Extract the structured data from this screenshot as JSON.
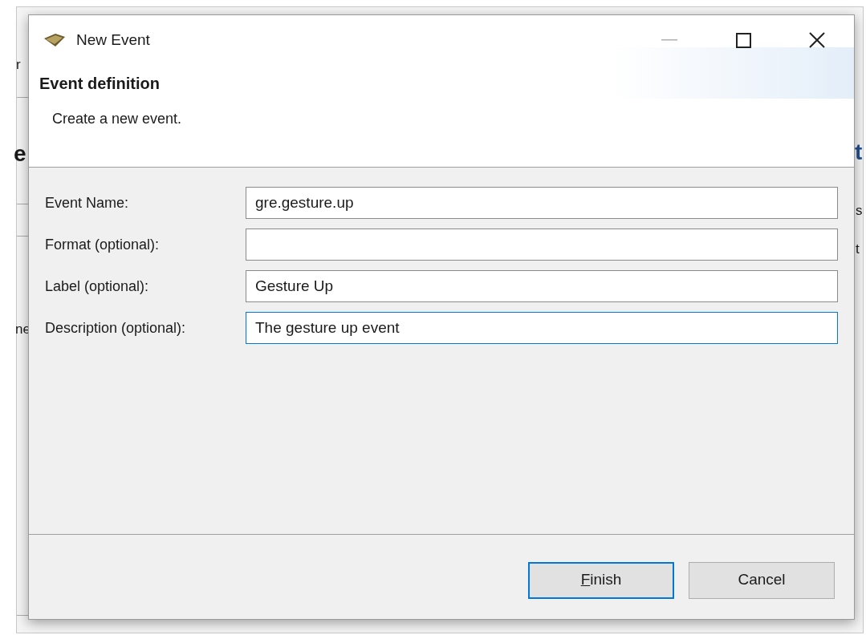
{
  "background_fragments": [
    {
      "text": "r",
      "kind": "plain"
    },
    {
      "text": "e",
      "kind": "heading"
    },
    {
      "text": "ne",
      "kind": "plain"
    },
    {
      "text": "t",
      "kind": "heading"
    },
    {
      "text": "s",
      "kind": "plain"
    },
    {
      "text": "t",
      "kind": "plain"
    }
  ],
  "dialog": {
    "title": "New Event",
    "controls": [
      {
        "kind": "minimize",
        "disabled": true
      },
      {
        "kind": "maximize",
        "disabled": false
      },
      {
        "kind": "close",
        "disabled": false
      }
    ],
    "header": {
      "title": "Event definition",
      "description": "Create a new event."
    },
    "fields": [
      {
        "label": "Event Name:",
        "value": "gre.gesture.up",
        "focused": false
      },
      {
        "label": "Format (optional):",
        "focused": false
      },
      {
        "label": "Label (optional):",
        "value": "Gesture Up",
        "focused": false
      },
      {
        "label": "Description (optional):",
        "value": "The gesture up event",
        "focused": true
      }
    ],
    "buttons": [
      {
        "label": "Finish",
        "default": true,
        "mnemonic": true
      },
      {
        "label": "Cancel",
        "default": false,
        "mnemonic": false
      }
    ]
  }
}
